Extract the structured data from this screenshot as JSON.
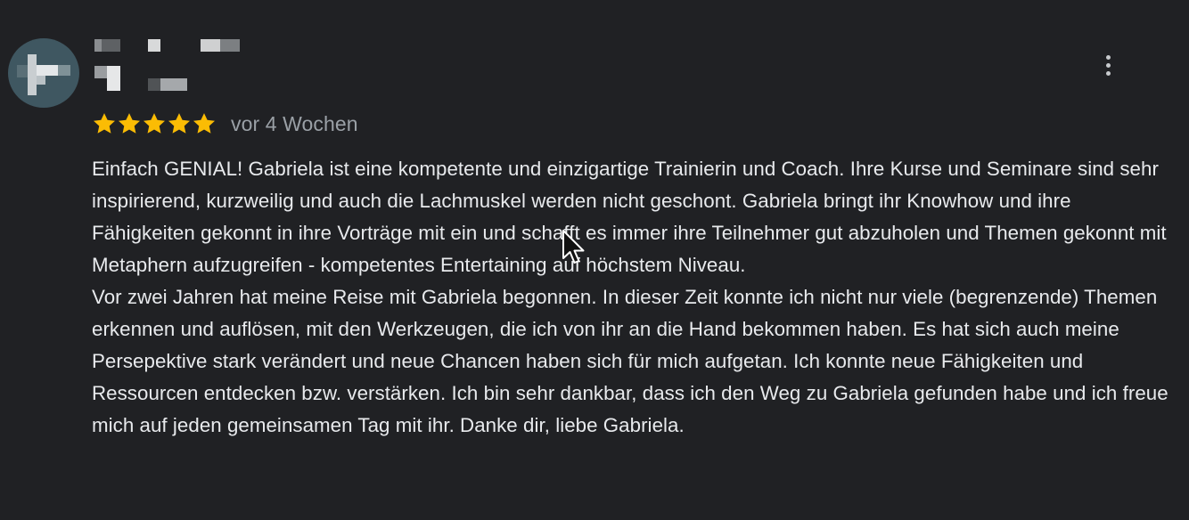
{
  "review": {
    "date": "vor 4 Wochen",
    "rating": 5,
    "rating_max": 5,
    "star_color": "#fbbc04",
    "paragraphs": [
      "Einfach GENIAL! Gabriela ist eine kompetente und einzigartige Trainierin und Coach. Ihre Kurse und Seminare sind sehr inspirierend, kurzweilig und auch die Lachmuskel werden nicht geschont. Gabriela bringt ihr Knowhow und ihre Fähigkeiten gekonnt in ihre Vorträge mit ein und schafft es immer ihre Teilnehmer gut abzuholen und Themen gekonnt mit Metaphern aufzugreifen - kompetentes Entertaining auf höchstem Niveau.",
      "Vor zwei Jahren hat meine Reise mit Gabriela begonnen. In dieser Zeit konnte ich nicht nur viele (begrenzende) Themen erkennen und auflösen, mit den Werkzeugen, die ich von ihr an die Hand bekommen haben. Es hat sich auch meine Persepektive stark verändert und neue Chancen haben sich für mich aufgetan. Ich konnte neue Fähigkeiten und Ressourcen entdecken bzw. verstärken. Ich bin sehr dankbar, dass ich den Weg zu Gabriela gefunden habe und ich freue mich auf jeden gemeinsamen Tag mit ihr. Danke dir, liebe Gabriela."
    ]
  },
  "icons": {
    "more": "more-vert-icon",
    "star": "star-icon",
    "cursor": "mouse-pointer-icon"
  }
}
